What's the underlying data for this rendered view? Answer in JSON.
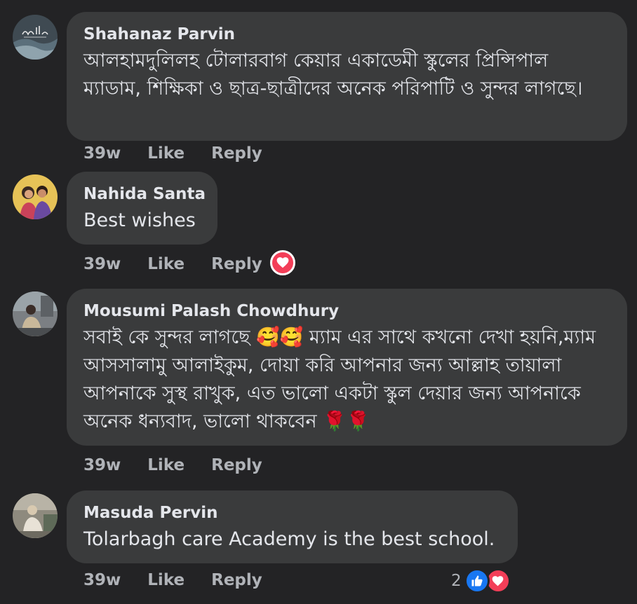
{
  "comments": [
    {
      "author": "Shahanaz Parvin",
      "avatar_icon": "calligraphy-avatar-icon",
      "text": "আলহামদুলিলহ টোলারবাগ কেয়ার একাডেমী স্কুলের প্রিন্সিপাল ম্যাডাম, শিক্ষিকা ও ছাত্র-ছাত্রীদের অনেক পরিপাটি ও সুন্দর লাগছে।",
      "time": "39w",
      "like_label": "Like",
      "reply_label": "Reply"
    },
    {
      "author": "Nahida Santa",
      "avatar_icon": "couple-photo-avatar-icon",
      "text": "Best wishes",
      "time": "39w",
      "like_label": "Like",
      "reply_label": "Reply",
      "reactions": [
        "heart-icon"
      ]
    },
    {
      "author": "Mousumi Palash Chowdhury",
      "avatar_icon": "photo-avatar-icon",
      "text": "সবাই কে সুন্দর লাগছে 🥰🥰 ম্যাম এর সাথে কখনো দেখা হয়নি,ম্যাম আসসালামু আলাইকুম, দোয়া করি আপনার জন্য আল্লাহ তায়ালা আপনাকে সুস্থ রাখুক, এত ভালো একটা স্কুল দেয়ার জন্য আপনাকে অনেক ধন্যবাদ, ভালো থাকবেন 🌹🌹",
      "time": "39w",
      "like_label": "Like",
      "reply_label": "Reply"
    },
    {
      "author": "Masuda Pervin",
      "avatar_icon": "photo-avatar-icon",
      "text": "Tolarbagh care Academy is the best school.",
      "time": "39w",
      "like_label": "Like",
      "reply_label": "Reply",
      "reaction_count": "2",
      "reactions": [
        "like-icon",
        "heart-icon"
      ]
    }
  ],
  "colors": {
    "background": "#232325",
    "bubble": "#3a3b3c",
    "text": "#e4e6eb",
    "secondary_text": "#b0b3b8",
    "like_blue": "#1877f2",
    "love_red": "#f33e58"
  }
}
